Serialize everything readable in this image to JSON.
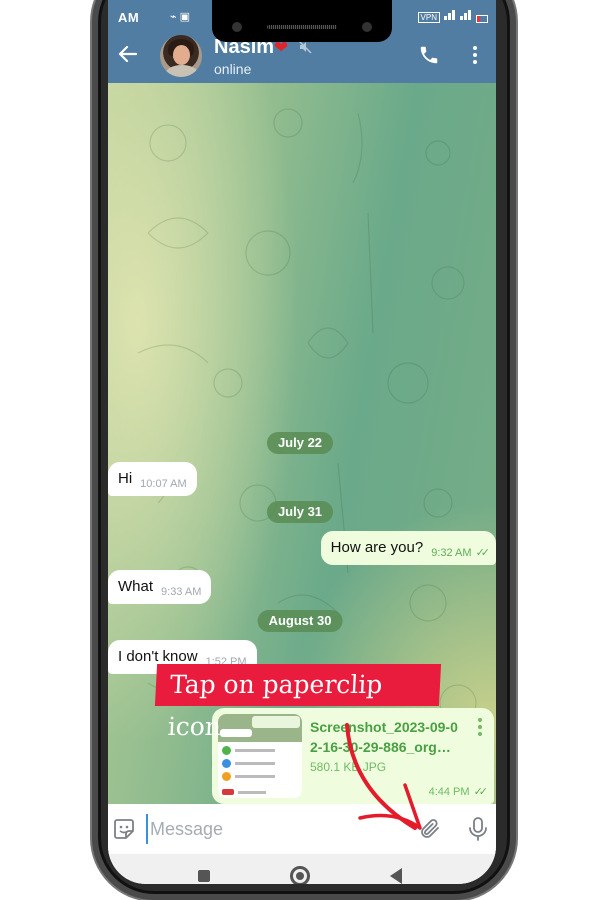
{
  "status_bar": {
    "time": "AM",
    "right_indicators": "VPN"
  },
  "header": {
    "contact_name": "Nasim",
    "name_emoji": "❤",
    "status": "online",
    "icons": [
      "back-arrow-icon",
      "avatar",
      "mute-icon",
      "phone-icon",
      "more-vertical-icon"
    ]
  },
  "chat": {
    "date_separators": [
      "July 22",
      "July 31",
      "August 30"
    ],
    "messages": [
      {
        "direction": "incoming",
        "text": "Hi",
        "time": "10:07 AM"
      },
      {
        "direction": "outgoing",
        "text": "How are you?",
        "time": "9:32 AM",
        "read": true
      },
      {
        "direction": "incoming",
        "text": "What",
        "time": "9:33 AM"
      },
      {
        "direction": "incoming",
        "text": "I don't know",
        "time": "1:52 PM"
      }
    ],
    "file_message": {
      "direction": "outgoing",
      "file_name": "Screenshot_2023-09-02-16-30-29-886_org…",
      "file_name_line1": "Screenshot_2023-09-0",
      "file_name_line2": "2-16-30-29-886_org…",
      "size": "580.1 KB JPG",
      "time": "4:44 PM",
      "read": true
    },
    "checks": "✓✓"
  },
  "annotation": {
    "callout_text": "Tap on paperclip icon",
    "color": "#ea1c3d"
  },
  "input_bar": {
    "placeholder": "Message",
    "value": ""
  },
  "colors": {
    "header": "#517da2",
    "outgoing_bubble": "#effdde",
    "accent_green": "#5fad55",
    "date_pill": "#588a50"
  }
}
